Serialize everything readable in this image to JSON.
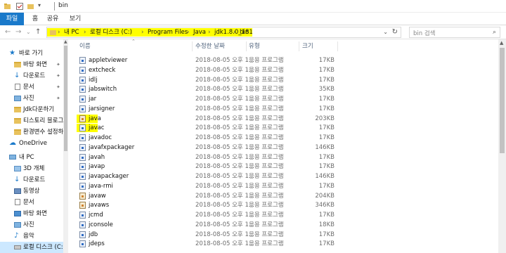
{
  "window": {
    "title": "bin"
  },
  "ribbon": {
    "tabs": [
      "파일",
      "홈",
      "공유",
      "보기"
    ]
  },
  "address": {
    "crumbs": [
      "내 PC",
      "로컬 디스크 (C:)",
      "Program Files",
      "Java",
      "jdk1.8.0_181",
      "bin"
    ],
    "separator": "›",
    "refresh_icon": "↻",
    "dropdown_icon": "⌄"
  },
  "search": {
    "placeholder": "bin 검색",
    "icon": "⌕"
  },
  "nav_buttons": {
    "back": "←",
    "forward": "→",
    "recent": "⌄",
    "up": "↑"
  },
  "sidebar": {
    "items": [
      {
        "label": "바로 가기",
        "icon": "star-icon",
        "pinned": false
      },
      {
        "label": "바탕 화면",
        "icon": "folder-icon",
        "pinned": true
      },
      {
        "label": "다운로드",
        "icon": "download-icon",
        "pinned": true
      },
      {
        "label": "문서",
        "icon": "document-icon",
        "pinned": true
      },
      {
        "label": "사진",
        "icon": "pictures-icon",
        "pinned": true
      },
      {
        "label": "Jdk다운하기",
        "icon": "folder-icon",
        "pinned": false
      },
      {
        "label": "티스토리 블로그",
        "icon": "folder-icon",
        "pinned": false
      },
      {
        "label": "환경변수 설정하기",
        "icon": "folder-icon",
        "pinned": false
      },
      {
        "label": "OneDrive",
        "icon": "cloud-icon",
        "pinned": false
      },
      {
        "label": "내 PC",
        "icon": "computer-icon",
        "pinned": false
      },
      {
        "label": "3D 개체",
        "icon": "folder-icon",
        "pinned": false
      },
      {
        "label": "다운로드",
        "icon": "download-icon",
        "pinned": false
      },
      {
        "label": "동영상",
        "icon": "video-icon",
        "pinned": false
      },
      {
        "label": "문서",
        "icon": "document-icon",
        "pinned": false
      },
      {
        "label": "바탕 화면",
        "icon": "folder-icon",
        "pinned": false
      },
      {
        "label": "사진",
        "icon": "pictures-icon",
        "pinned": false
      },
      {
        "label": "음악",
        "icon": "music-icon",
        "pinned": false
      },
      {
        "label": "로컬 디스크 (C:)",
        "icon": "drive-icon",
        "pinned": false
      }
    ],
    "pin_glyph": "📌",
    "colors": {
      "selected": "#cce8ff",
      "star": "#1979ca",
      "folder": "#e8c25d",
      "cloud": "#1979ca"
    }
  },
  "columns": {
    "name": "이름",
    "date": "수정한 날짜",
    "type": "유형",
    "size": "크기"
  },
  "files": [
    {
      "name": "appletviewer",
      "date": "2018-08-05 오후 1...",
      "type": "응용 프로그램",
      "size": "17KB"
    },
    {
      "name": "extcheck",
      "date": "2018-08-05 오후 1...",
      "type": "응용 프로그램",
      "size": "17KB"
    },
    {
      "name": "idlj",
      "date": "2018-08-05 오후 1...",
      "type": "응용 프로그램",
      "size": "17KB"
    },
    {
      "name": "jabswitch",
      "date": "2018-08-05 오후 1...",
      "type": "응용 프로그램",
      "size": "35KB"
    },
    {
      "name": "jar",
      "date": "2018-08-05 오후 1...",
      "type": "응용 프로그램",
      "size": "17KB"
    },
    {
      "name": "jarsigner",
      "date": "2018-08-05 오후 1...",
      "type": "응용 프로그램",
      "size": "17KB"
    },
    {
      "name": "java",
      "date": "2018-08-05 오후 1...",
      "type": "응용 프로그램",
      "size": "203KB",
      "highlight": true,
      "jar": true
    },
    {
      "name": "javac",
      "date": "2018-08-05 오후 1...",
      "type": "응용 프로그램",
      "size": "17KB",
      "highlight": true
    },
    {
      "name": "javadoc",
      "date": "2018-08-05 오후 1...",
      "type": "응용 프로그램",
      "size": "17KB"
    },
    {
      "name": "javafxpackager",
      "date": "2018-08-05 오후 1...",
      "type": "응용 프로그램",
      "size": "146KB"
    },
    {
      "name": "javah",
      "date": "2018-08-05 오후 1...",
      "type": "응용 프로그램",
      "size": "17KB"
    },
    {
      "name": "javap",
      "date": "2018-08-05 오후 1...",
      "type": "응용 프로그램",
      "size": "17KB"
    },
    {
      "name": "javapackager",
      "date": "2018-08-05 오후 1...",
      "type": "응용 프로그램",
      "size": "146KB"
    },
    {
      "name": "java-rmi",
      "date": "2018-08-05 오후 1...",
      "type": "응용 프로그램",
      "size": "17KB"
    },
    {
      "name": "javaw",
      "date": "2018-08-05 오후 1...",
      "type": "응용 프로그램",
      "size": "204KB",
      "jar": true
    },
    {
      "name": "javaws",
      "date": "2018-08-05 오후 1...",
      "type": "응용 프로그램",
      "size": "346KB",
      "jar": true
    },
    {
      "name": "jcmd",
      "date": "2018-08-05 오후 1...",
      "type": "응용 프로그램",
      "size": "17KB"
    },
    {
      "name": "jconsole",
      "date": "2018-08-05 오후 1...",
      "type": "응용 프로그램",
      "size": "18KB"
    },
    {
      "name": "jdb",
      "date": "2018-08-05 오후 1...",
      "type": "응용 프로그램",
      "size": "17KB"
    },
    {
      "name": "jdeps",
      "date": "2018-08-05 오후 1...",
      "type": "응용 프로그램",
      "size": "17KB"
    }
  ],
  "colors": {
    "highlight": "#ffff00",
    "file_tab": "#1979ca",
    "header_text": "#4c607a"
  }
}
